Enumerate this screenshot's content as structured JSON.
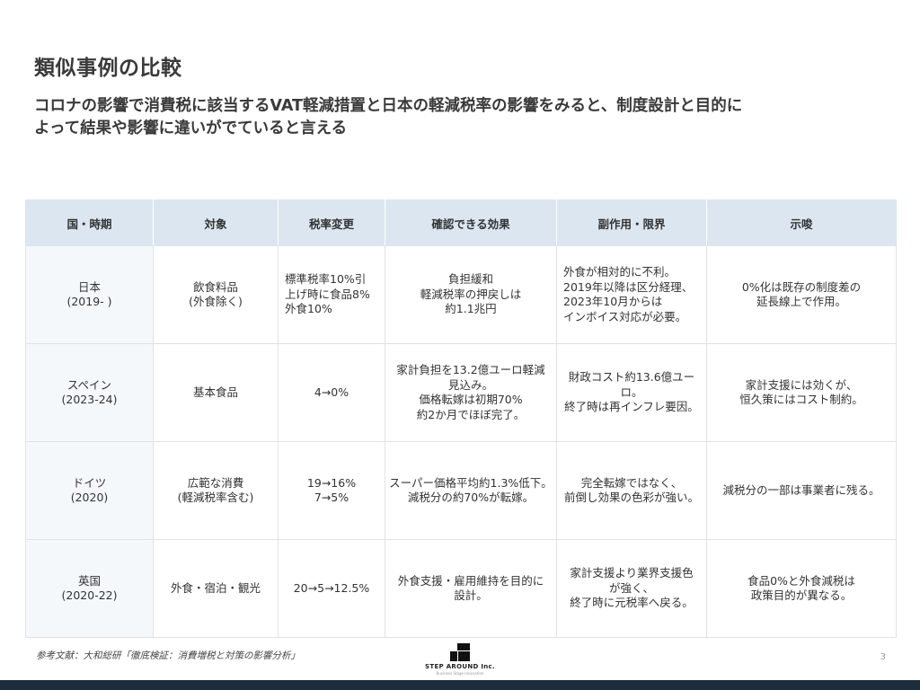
{
  "slide": {
    "title": "類似事例の比較",
    "subtitle_lines": [
      "コロナの影響で消費税に該当するVAT軽減措置と日本の軽減税率の影響をみると、制度設計と目的に",
      "よって結果や影響に違いがでていると言える"
    ]
  },
  "table": {
    "headers": [
      "国・時期",
      "対象",
      "税率変更",
      "確認できる効果",
      "副作用・限界",
      "示唆"
    ],
    "rows": [
      {
        "country": [
          "日本",
          "(2019- )"
        ],
        "target": [
          "飲食料品",
          "(外食除く)"
        ],
        "rate": [
          "標準税率10%引",
          "上げ時に食品8%",
          "外食10%"
        ],
        "effect": [
          "負担緩和",
          "軽減税率の押戻しは",
          "約1.1兆円"
        ],
        "side": [
          "外食が相対的に不利。",
          "2019年以降は区分経理、",
          "2023年10月からは",
          "インボイス対応が必要。"
        ],
        "implication": [
          "0%化は既存の制度差の",
          "延長線上で作用。"
        ]
      },
      {
        "country": [
          "スペイン",
          "(2023-24)"
        ],
        "target": [
          "基本食品"
        ],
        "rate": [
          "4→0%"
        ],
        "effect": [
          "家計負担を13.2億ユーロ軽減",
          "見込み。",
          "価格転嫁は初期70%",
          "約2か月でほぼ完了。"
        ],
        "side": [
          "財政コスト約13.6億ユーロ。",
          "終了時は再インフレ要因。"
        ],
        "implication": [
          "家計支援には効くが、",
          "恒久策にはコスト制約。"
        ]
      },
      {
        "country": [
          "ドイツ",
          "(2020)"
        ],
        "target": [
          "広範な消費",
          "(軽減税率含む)"
        ],
        "rate": [
          "19→16%",
          "7→5%"
        ],
        "effect": [
          "スーパー価格平均約1.3%低下。",
          "減税分の約70%が転嫁。"
        ],
        "side": [
          "完全転嫁ではなく、",
          "前倒し効果の色彩が強い。"
        ],
        "implication": [
          "減税分の一部は事業者に残る。"
        ]
      },
      {
        "country": [
          "英国",
          "(2020-22)"
        ],
        "target": [
          "外食・宿泊・観光"
        ],
        "rate": [
          "20→5→12.5%"
        ],
        "effect": [
          "外食支援・雇用維持を目的に",
          "設計。"
        ],
        "side": [
          "家計支援より業界支援色",
          "が強く、",
          "終了時に元税率へ戻る。"
        ],
        "implication": [
          "食品0%と外食減税は",
          "政策目的が異なる。"
        ]
      }
    ]
  },
  "footer": {
    "reference": "参考文献：大和総研「徹底検証：消費増税と対策の影響分析」",
    "logo_text": "STEP AROUND Inc.",
    "logo_tagline": "Business Stage Innovation",
    "page_number": "3"
  },
  "colors": {
    "header_bg": "#dce6f0",
    "bottom_bar": "#1e2d3d"
  }
}
